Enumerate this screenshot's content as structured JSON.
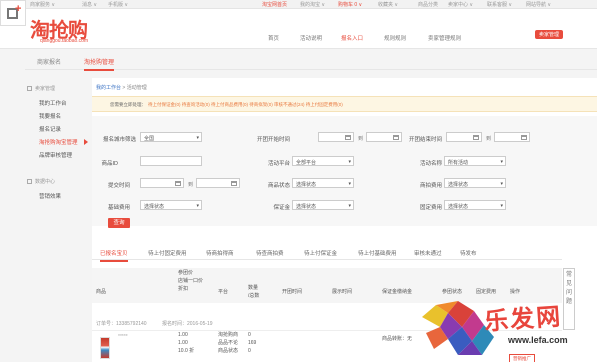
{
  "topbar": {
    "items": [
      "商家服务 ∨",
      "消息 ∨",
      "手机版 ∨",
      "淘宝网首页",
      "我的淘宝 ∨",
      "购物车 0 ∨",
      "收藏夹 ∨",
      "商品分类",
      "卖家中心 ∨",
      "联系客服 ∨",
      "网站导航 ∨"
    ]
  },
  "header": {
    "logo": "淘抢购",
    "logo_sub": "qianggou.taobao.com",
    "nav": [
      "首页",
      "活动说明",
      "报名入口",
      "规则规则",
      "卖家管理规则"
    ],
    "nav_active_index": 2,
    "seller_button": "卖家管理"
  },
  "tabs": [
    "商家报名",
    "淘抢购管理"
  ],
  "tabs_active_index": 1,
  "sidebar": {
    "group1": "卖家管理",
    "items1": [
      "我的工作台",
      "我要报名",
      "报名记录",
      "淘抢购淘宝管理",
      "品牌审核管理"
    ],
    "active_item": 3,
    "group2": "数据中心",
    "items2": [
      "营销效果"
    ]
  },
  "crumb": {
    "link": "我的工作台",
    "sep": " > ",
    "current": "活动管理"
  },
  "notice": {
    "lead": "您需要立即处理：",
    "rest": "待上付保证金(0) 待查询活动(0) 待上付商品费用(0) 待商拟架(0) 审核不通过(24) 待上付固定费用(0)"
  },
  "form": {
    "row1": {
      "city_label": "报名城市筛选",
      "city_value": "全国",
      "start_label": "开团开始时间",
      "to": "到",
      "end_label": "开团结束时间"
    },
    "row2": {
      "item_label": "商品ID",
      "platform_label": "活动平台",
      "platform_value": "全部平台",
      "activity_label": "活动名称",
      "activity_value": "所有活动"
    },
    "row3": {
      "submit_label": "提交时间",
      "to": "到",
      "status_label": "商品状态",
      "status_value": "选择状态",
      "fee_label": "商拍费用",
      "fee_value": "选择状态"
    },
    "row4": {
      "base_fee_label": "基础费用",
      "base_fee_value": "选择状态",
      "deposit_label": "保证金",
      "deposit_value": "选择状态",
      "fixed_fee_label": "固定费用",
      "fixed_fee_value": "选择状态"
    },
    "query_button": "查询"
  },
  "status_tabs": [
    "已报名宝贝",
    "待上付固定费用",
    "待商拍得商",
    "待查商拍费",
    "待上付保证金",
    "待上付基础费用",
    "审核未通过",
    "待发布"
  ],
  "status_tabs_active_index": 0,
  "table": {
    "headers": {
      "product": "商品",
      "price": [
        "参团价",
        "店铺一口价",
        "折扣"
      ],
      "platform": "平台",
      "count": [
        "数量",
        "/总数"
      ],
      "group_time": "开团时间",
      "display_time": "展示时间",
      "deposit": "保证金缴纳金",
      "fee_status": "参团状态",
      "fixed": "固定费用",
      "op": "操作"
    },
    "order": {
      "phone": "订单号：13385792140",
      "date": "报名时间：2016-05-19"
    },
    "row": {
      "name": "*****",
      "prices": [
        "1.00",
        "1.00",
        "10.0 折"
      ],
      "platform": [
        "淘抢购商",
        "品品不论",
        "商品状态"
      ],
      "count": [
        "0",
        "169",
        "0"
      ],
      "deposit": "商品转账：无",
      "op_button": "营销推广"
    }
  },
  "float_tab": "常见问题",
  "watermark": {
    "text": "乐发网",
    "url": "www.lefa.com"
  }
}
